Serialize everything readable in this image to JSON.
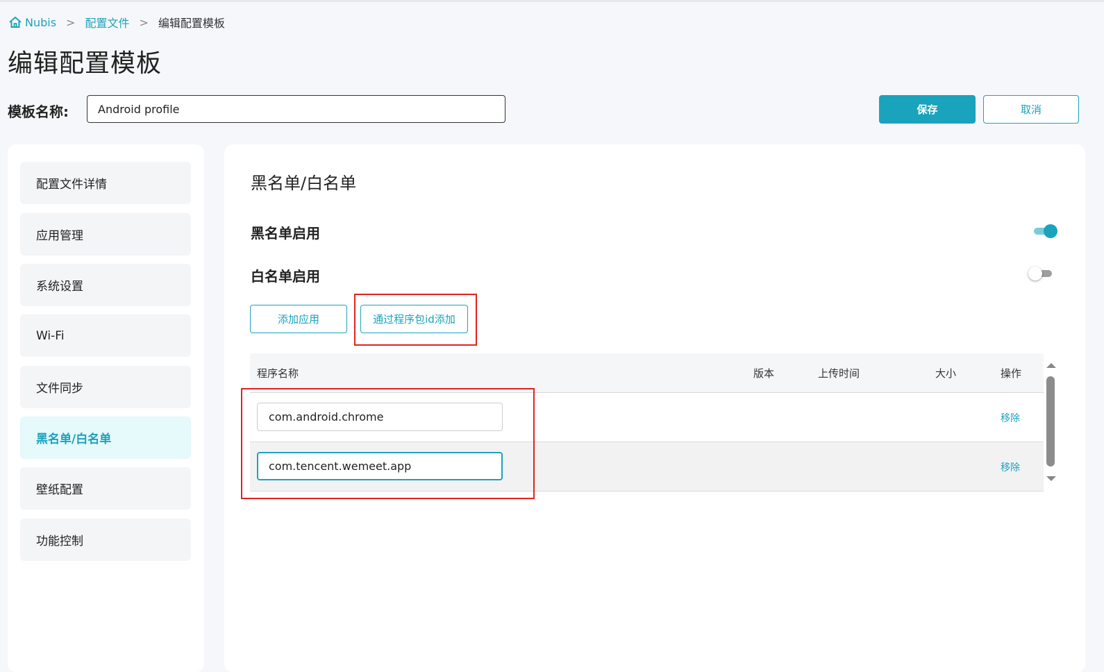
{
  "breadcrumb": {
    "home": "Nubis",
    "parent": "配置文件",
    "current": "编辑配置模板",
    "separator": ">"
  },
  "page_title": "编辑配置模板",
  "template_name": {
    "label": "模板名称:",
    "value": "Android profile"
  },
  "actions": {
    "save": "保存",
    "cancel": "取消"
  },
  "sidebar": {
    "items": [
      {
        "label": "配置文件详情",
        "active": false
      },
      {
        "label": "应用管理",
        "active": false
      },
      {
        "label": "系统设置",
        "active": false
      },
      {
        "label": "Wi-Fi",
        "active": false
      },
      {
        "label": "文件同步",
        "active": false
      },
      {
        "label": "黑名单/白名单",
        "active": true
      },
      {
        "label": "壁纸配置",
        "active": false
      },
      {
        "label": "功能控制",
        "active": false
      }
    ]
  },
  "main": {
    "title": "黑名单/白名单",
    "blacklist_toggle": {
      "label": "黑名单启用",
      "enabled": true
    },
    "whitelist_toggle": {
      "label": "白名单启用",
      "enabled": false
    },
    "add_app_button": "添加应用",
    "add_by_package_button": "通过程序包id添加",
    "table": {
      "columns": [
        "程序名称",
        "版本",
        "上传时间",
        "大小",
        "操作"
      ],
      "rows": [
        {
          "package": "com.android.chrome",
          "action": "移除"
        },
        {
          "package": "com.tencent.wemeet.app",
          "action": "移除"
        }
      ]
    }
  },
  "colors": {
    "accent": "#1aa3bd",
    "highlight": "#e2221e",
    "active_nav_bg": "#e6f9fb"
  },
  "icons": {
    "home": "home-icon",
    "scroll_up": "caret-up-icon",
    "scroll_down": "caret-down-icon"
  }
}
